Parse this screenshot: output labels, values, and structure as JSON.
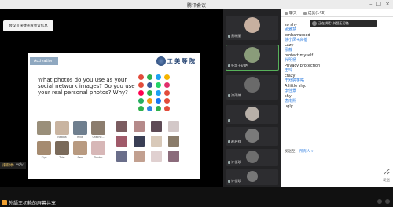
{
  "window": {
    "title": "腾讯会议"
  },
  "notice": {
    "text": "会议可快捷查看会议信息"
  },
  "slide": {
    "tag": "Activation",
    "logo_text": "工 美 等 院",
    "question": "What photos do you use as your social network images? Do you use your real personal photos? Why?",
    "photos": [
      {
        "label": "",
        "color": "#9a8f7a"
      },
      {
        "label": "Natalia",
        "color": "#c9b4a0"
      },
      {
        "label": "Rival",
        "color": "#6f7f8f"
      },
      {
        "label": "Cheche...",
        "color": "#8c7d6e"
      },
      {
        "label": "Kiyo",
        "color": "#a58b70"
      },
      {
        "label": "Tyler",
        "color": "#7a6a5a"
      },
      {
        "label": "Sam",
        "color": "#b89a80"
      },
      {
        "label": "Dexter",
        "color": "#d7b7b7"
      }
    ],
    "thumbs": [
      "#7b5c60",
      "#b58a8a",
      "#5e4b56",
      "#d3c8c8",
      "#a05a6a",
      "#3a3f55",
      "#d8c9b9",
      "#8a7c6a",
      "#6a6e8a",
      "#c2a090",
      "#e0d0d0",
      "#8b6b7b"
    ],
    "apps": [
      "#e24c3b",
      "#2fb14c",
      "#1da1f2",
      "#f5b400",
      "#e24c3b",
      "#3b5998",
      "#25d366",
      "#e1306c",
      "#ff0050",
      "#2fb14c",
      "#1da1f2",
      "#e24c3b",
      "#27ae60",
      "#f39c12",
      "#1877f2",
      "#e24c3b",
      "#2fb14c",
      "#2e86de",
      "#2fb14c",
      "#e24c3b"
    ]
  },
  "speaker": {
    "name": "漆雨婷:",
    "label": "ugly"
  },
  "share_bar": {
    "text": "外語王初艳的屏幕共享"
  },
  "participants": [
    {
      "name": "黄晓丽",
      "color": "#c7b0a0",
      "active": false
    },
    {
      "name": "外語王初艳",
      "color": "#8a9c7a",
      "active": true
    },
    {
      "name": "漆雨婷",
      "color": "#6a6a6a",
      "active": false
    },
    {
      "name": "",
      "color": "#b8b0a8",
      "active": false
    },
    {
      "name": "赵启祥",
      "color": "#7a7a7a",
      "active": false
    },
    {
      "name": "许佳珍",
      "color": "#6e6e6e",
      "active": false
    },
    {
      "name": "许佳珍",
      "color": "#777777",
      "active": false
    }
  ],
  "chat": {
    "tabs": {
      "chat": "聊天",
      "members": "成员(143)"
    },
    "toast": "正在讲话: 外語王初艳",
    "messages": [
      {
        "text": "so shy",
        "name": "孟雅慧"
      },
      {
        "text": "embarrassed",
        "name": "徐小凤+高蓓"
      },
      {
        "text": "Lazy",
        "name": "廖静"
      },
      {
        "text": "protect myself",
        "name": "代明杨"
      },
      {
        "text": "Privacy protection",
        "name": "王玲"
      },
      {
        "text": "crazy",
        "name": "王舒婷笑咯"
      },
      {
        "text": "A little shy.",
        "name": "李佳景"
      },
      {
        "text": "shy",
        "name": "唐南熙"
      },
      {
        "text": "ugly",
        "name": ""
      }
    ],
    "send_label": "发送至:",
    "send_to": "所有人 ▾",
    "input_placeholder": "",
    "send_button": "发送"
  }
}
